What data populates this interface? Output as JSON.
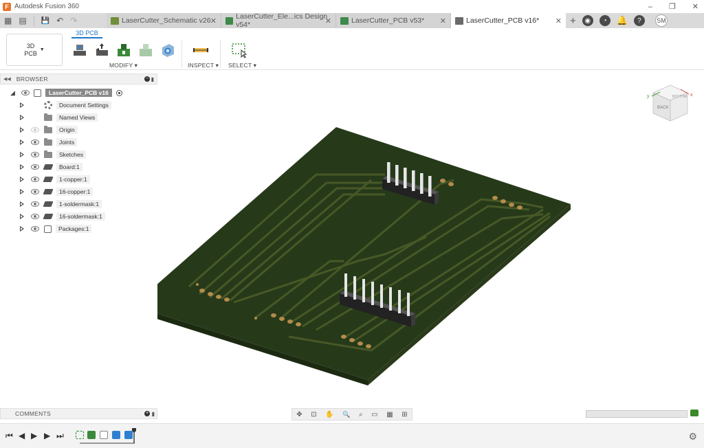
{
  "titlebar": {
    "app_title": "Autodesk Fusion 360",
    "logo": "F"
  },
  "window_controls": {
    "minimize": "–",
    "restore": "❐",
    "close": "✕"
  },
  "qat": {
    "grid_icon": "▦",
    "file_icon": "▤",
    "save_icon": "💾",
    "undo_icon": "↶",
    "redo_icon": "↷"
  },
  "tabs": [
    {
      "label": "LaserCutter_Schematic v26",
      "close": "✕",
      "color": "#6f8f3a"
    },
    {
      "label": "LaserCutter_Ele...ics Design v54*",
      "close": "✕",
      "color": "#3e8a4a"
    },
    {
      "label": "LaserCutter_PCB v53*",
      "close": "✕",
      "color": "#3e8a4a"
    },
    {
      "label": "LaserCutter_PCB v16*",
      "close": "✕",
      "color": "#6a6a6a"
    }
  ],
  "tab_tools": {
    "new_tab": "+",
    "user_initials": "SM"
  },
  "ribbon": {
    "workspace_line1": "3D",
    "workspace_line2": "PCB",
    "workspace_caret": "▼",
    "active_tab": "3D PCB",
    "groups": {
      "modify": "MODIFY ▾",
      "inspect": "INSPECT ▾",
      "select": "SELECT ▾"
    }
  },
  "browser": {
    "title": "BROWSER",
    "collapse_glyph": "◀◀",
    "root": "LaserCutter_PCB v16",
    "items": [
      {
        "label": "Document Settings",
        "icon": "gear-icon",
        "eye": false
      },
      {
        "label": "Named Views",
        "icon": "folder-icon",
        "eye": false
      },
      {
        "label": "Origin",
        "icon": "folder-icon",
        "eye": "dim"
      },
      {
        "label": "Joints",
        "icon": "folder-icon",
        "eye": true
      },
      {
        "label": "Sketches",
        "icon": "folder-icon",
        "eye": true
      },
      {
        "label": "Board:1",
        "icon": "layers-icon",
        "eye": true
      },
      {
        "label": "1-copper:1",
        "icon": "layers-icon",
        "eye": true
      },
      {
        "label": "16-copper:1",
        "icon": "layers-icon",
        "eye": true
      },
      {
        "label": "1-soldermask:1",
        "icon": "layers-icon",
        "eye": true
      },
      {
        "label": "16-soldermask:1",
        "icon": "layers-icon",
        "eye": true
      },
      {
        "label": "Packages:1",
        "icon": "package-icon",
        "eye": true
      }
    ]
  },
  "comments": {
    "title": "COMMENTS"
  },
  "nav_bar": {
    "orbit": "✥",
    "look": "⊡",
    "pan": "✋",
    "zoom": "🔍",
    "fit": "⌕",
    "display": "▭",
    "grid": "▦",
    "viewports": "⊞"
  },
  "viewcube": {
    "face_front": "BACK",
    "face_top": "BOTTOM",
    "axis_y": "y",
    "axis_x": "x"
  },
  "timeline": {
    "first": "⏮",
    "prev": "◀",
    "play": "▶",
    "next": "▶",
    "last": "⏭",
    "settings": "⚙"
  },
  "colors": {
    "board_top": "#263a1a",
    "board_edge": "#1c2a12",
    "trace": "#6d7a3a",
    "pad": "#b48c4a",
    "accent": "#1e78c8"
  }
}
